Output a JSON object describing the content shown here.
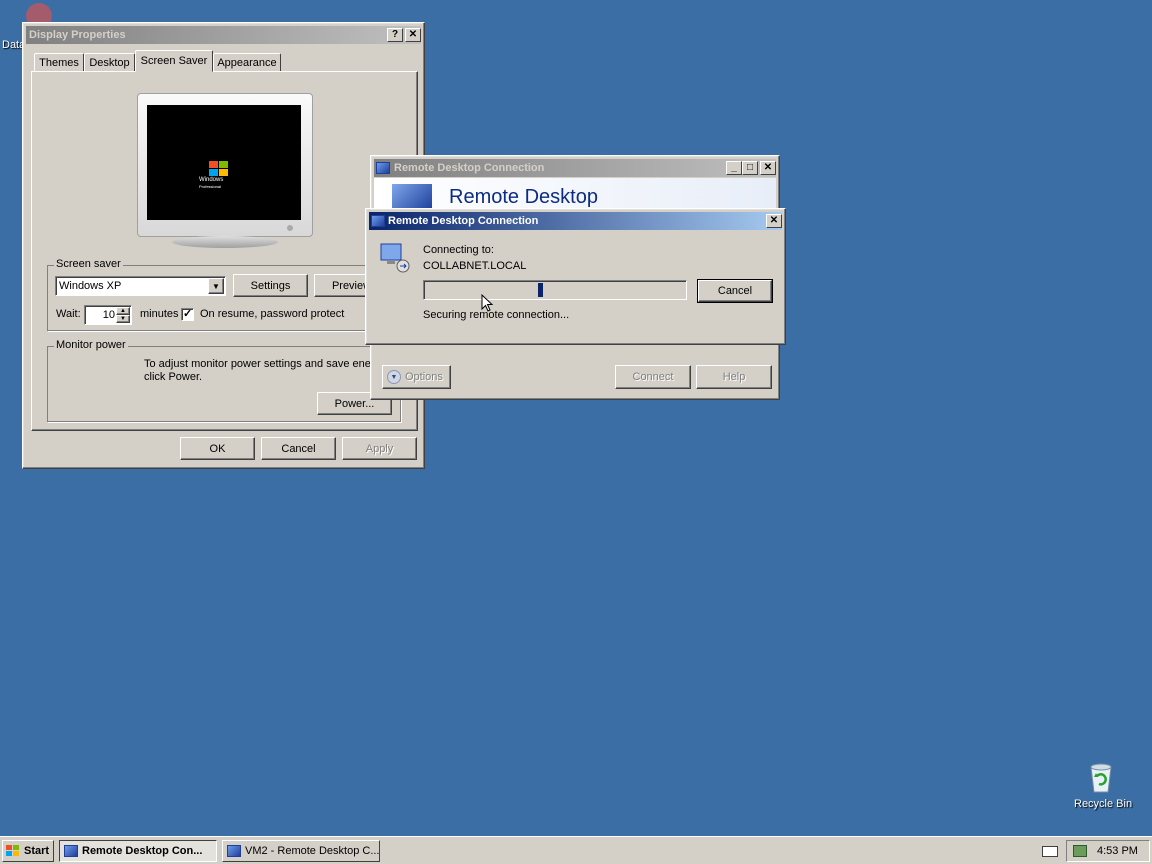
{
  "desktop": {
    "top_left_icon_label": "Data",
    "recycle_bin_label": "Recycle Bin"
  },
  "display_properties": {
    "title": "Display Properties",
    "help_btn": "?",
    "close_btn": "✕",
    "tabs": [
      "Themes",
      "Desktop",
      "Screen Saver",
      "Appearance"
    ],
    "monitor_logo": "Windows",
    "monitor_logo_sub": "Professional",
    "screen_saver_group": "Screen saver",
    "screen_saver_value": "Windows XP",
    "settings_btn": "Settings",
    "preview_btn": "Preview",
    "wait_label": "Wait:",
    "wait_value": "10",
    "minutes_label": "minutes",
    "password_protect_label": "On resume, password protect",
    "password_protect_checked": true,
    "monitor_power_group": "Monitor power",
    "power_text_1": "To adjust monitor power settings and save energy,",
    "power_text_2": "click Power.",
    "power_btn": "Power...",
    "ok_btn": "OK",
    "cancel_btn": "Cancel",
    "apply_btn": "Apply"
  },
  "rdc_back": {
    "title": "Remote Desktop Connection",
    "banner": "Remote Desktop",
    "options_btn": "Options",
    "connect_btn": "Connect",
    "help_btn": "Help"
  },
  "rdc_connecting": {
    "title": "Remote Desktop Connection",
    "connecting_to_label": "Connecting to:",
    "host": "COLLABNET.LOCAL",
    "cancel_btn": "Cancel",
    "status": "Securing remote connection...",
    "progress": 0.44
  },
  "taskbar": {
    "start_label": "Start",
    "tasks": [
      "Remote Desktop Con...",
      "VM2 - Remote Desktop C..."
    ],
    "clock": "4:53 PM"
  },
  "colors": {
    "desktop": "#3a6ea5",
    "title_active_start": "#0a246a",
    "title_active_end": "#a6caf0",
    "face": "#d4d0c8"
  }
}
